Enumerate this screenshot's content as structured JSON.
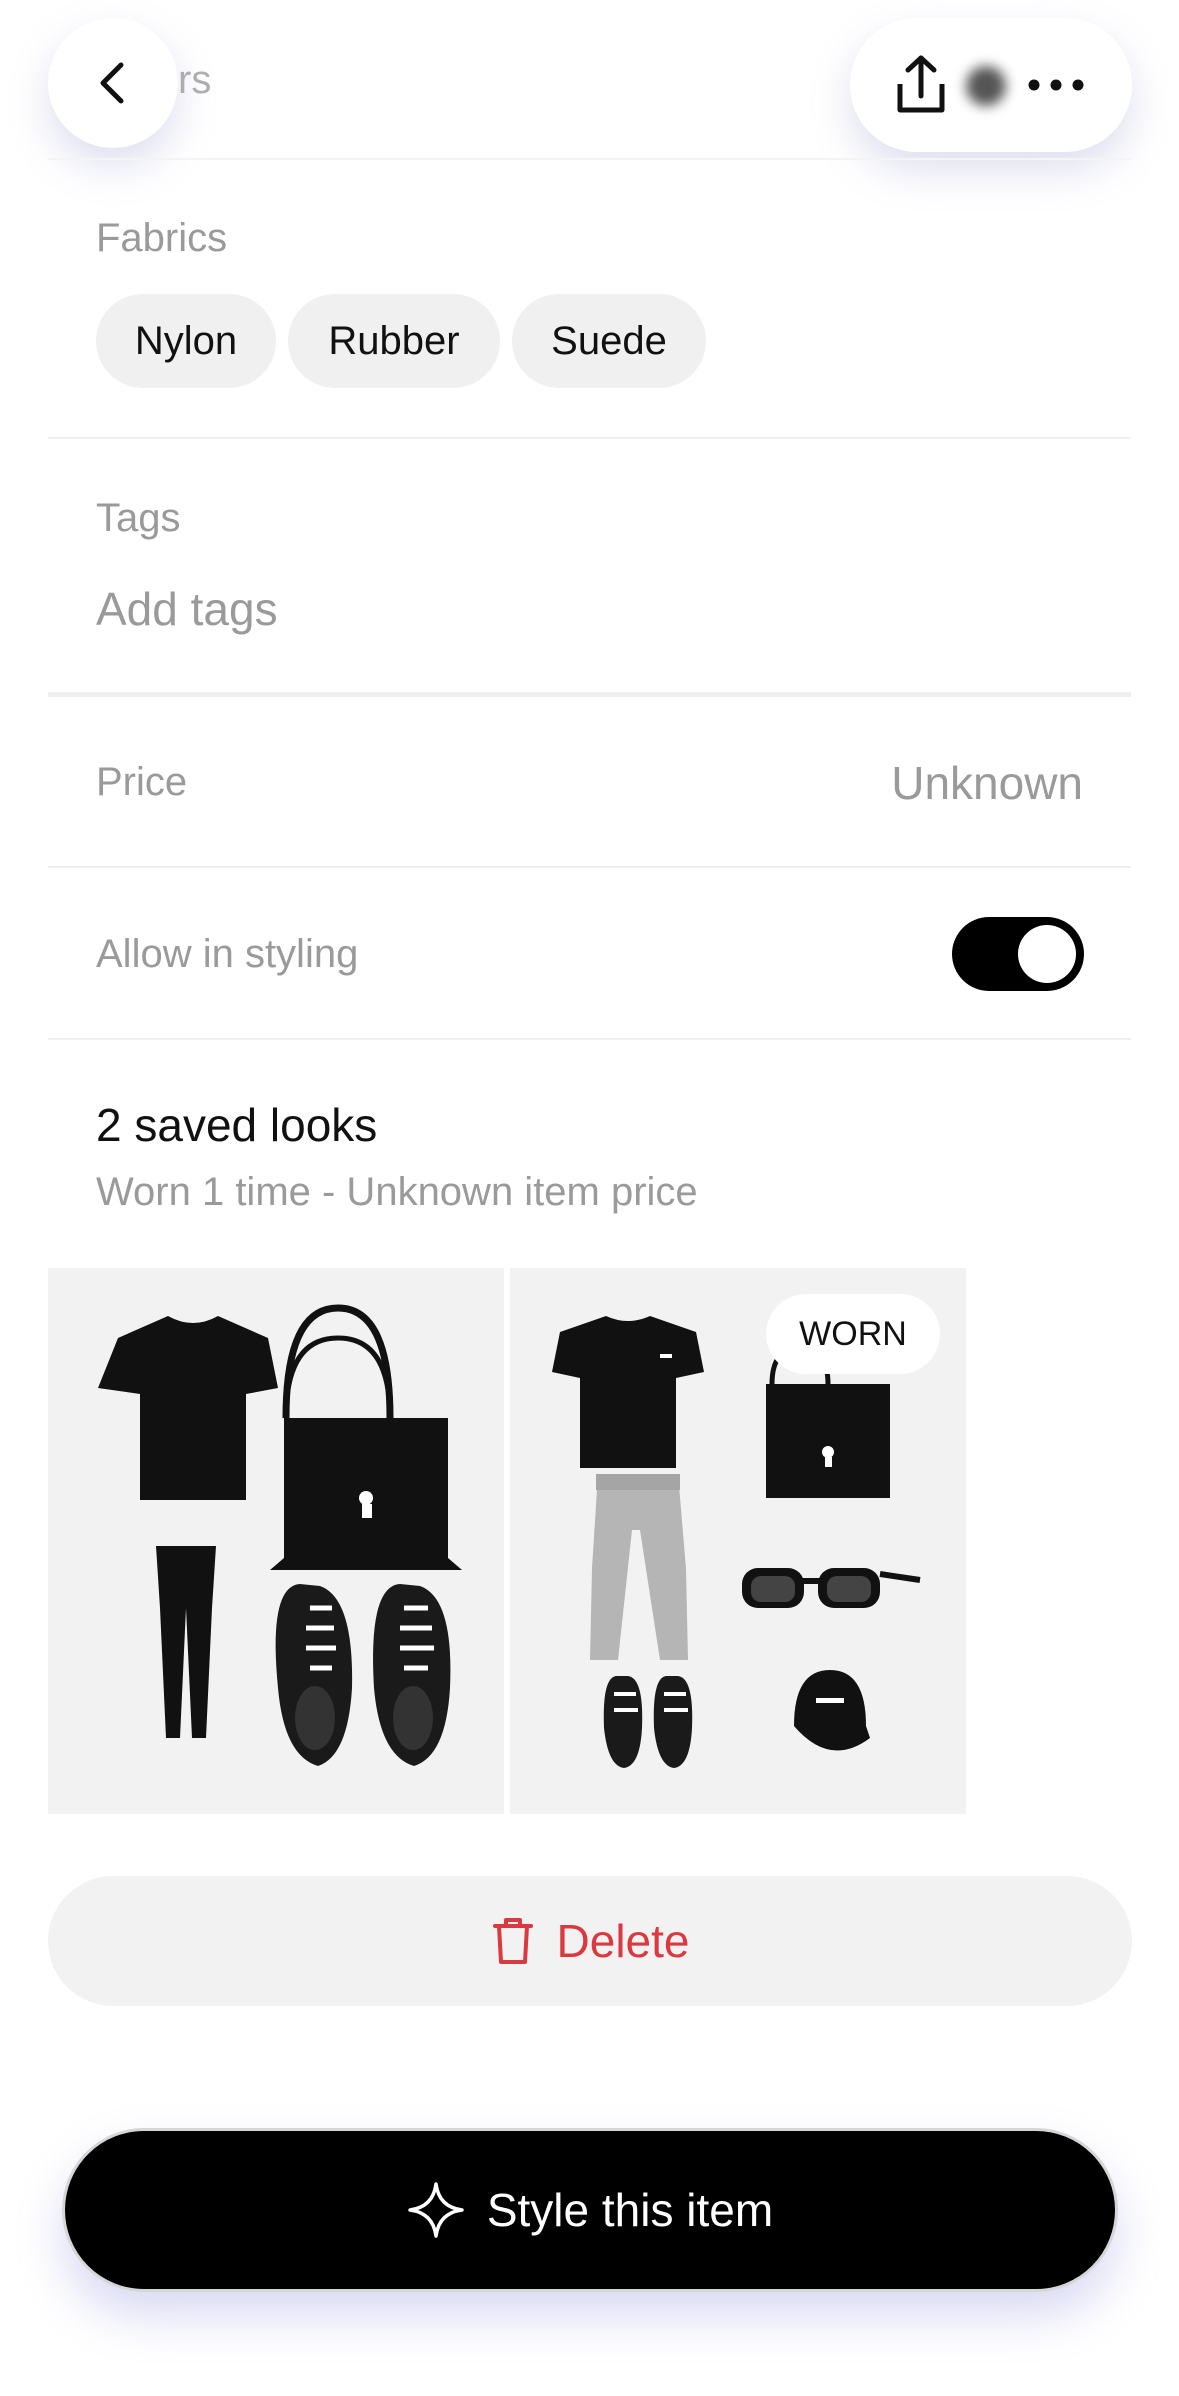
{
  "header": {
    "partial_title": "rs",
    "back_icon": "chevron-left-icon",
    "share_icon": "share-icon",
    "more_icon": "more-horizontal-icon"
  },
  "fabrics": {
    "label": "Fabrics",
    "chips": [
      "Nylon",
      "Rubber",
      "Suede"
    ]
  },
  "tags": {
    "label": "Tags",
    "placeholder": "Add tags"
  },
  "price": {
    "label": "Price",
    "value": "Unknown"
  },
  "styling": {
    "label": "Allow in styling",
    "enabled": true
  },
  "looks": {
    "title": "2 saved looks",
    "subtitle": "Worn 1 time - Unknown item price",
    "items": [
      {
        "badge": ""
      },
      {
        "badge": "WORN"
      }
    ]
  },
  "delete_button": {
    "label": "Delete",
    "color": "#d9393f"
  },
  "style_button": {
    "label": "Style this item"
  }
}
